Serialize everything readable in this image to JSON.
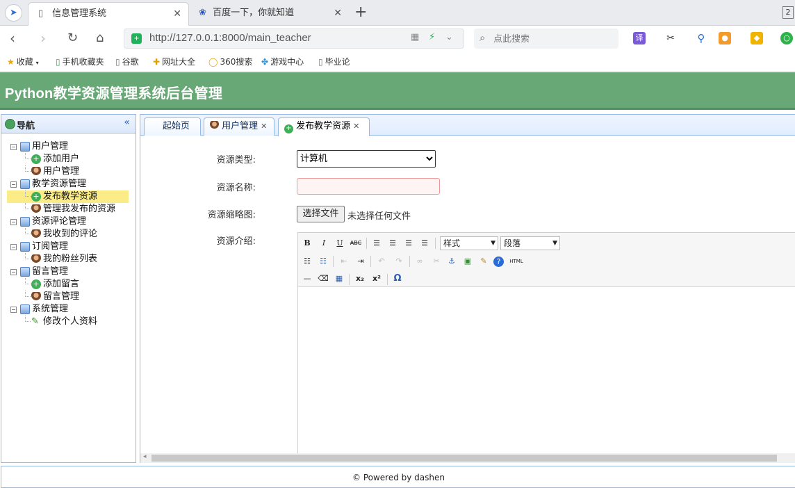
{
  "browser": {
    "tabs": [
      {
        "title": "信息管理系统",
        "active": true
      },
      {
        "title": "百度一下，你就知道",
        "active": false
      }
    ],
    "tab_count": "2",
    "url_prefix": "http://127.0.0.1",
    "url_rest": ":8000/main_teacher",
    "search_placeholder": "点此搜索",
    "translate_label": "译",
    "bookmarks": [
      "收藏",
      "手机收藏夹",
      "谷歌",
      "网址大全",
      "360搜索",
      "游戏中心",
      "毕业论"
    ]
  },
  "app": {
    "title": "Python教学资源管理系统后台管理",
    "nav_title": "导航",
    "nav_collapse": "«",
    "tree": [
      {
        "label": "用户管理",
        "level": 0,
        "icon": "folder-icon"
      },
      {
        "label": "添加用户",
        "level": 1,
        "icon": "add-icon"
      },
      {
        "label": "用户管理",
        "level": 1,
        "icon": "user-icon"
      },
      {
        "label": "教学资源管理",
        "level": 0,
        "icon": "folder-icon"
      },
      {
        "label": "发布教学资源",
        "level": 1,
        "icon": "add-icon",
        "selected": true
      },
      {
        "label": "管理我发布的资源",
        "level": 1,
        "icon": "user-icon"
      },
      {
        "label": "资源评论管理",
        "level": 0,
        "icon": "folder-icon"
      },
      {
        "label": "我收到的评论",
        "level": 1,
        "icon": "user-icon"
      },
      {
        "label": "订阅管理",
        "level": 0,
        "icon": "folder-icon"
      },
      {
        "label": "我的粉丝列表",
        "level": 1,
        "icon": "user-icon"
      },
      {
        "label": "留言管理",
        "level": 0,
        "icon": "folder-icon"
      },
      {
        "label": "添加留言",
        "level": 1,
        "icon": "add-icon"
      },
      {
        "label": "留言管理",
        "level": 1,
        "icon": "user-icon"
      },
      {
        "label": "系统管理",
        "level": 0,
        "icon": "folder-icon"
      },
      {
        "label": "修改个人资料",
        "level": 1,
        "icon": "edit-icon"
      }
    ],
    "main_tabs": [
      {
        "label": "起始页",
        "closable": false
      },
      {
        "label": "用户管理",
        "closable": true
      },
      {
        "label": "发布教学资源",
        "closable": true,
        "active": true
      }
    ],
    "form": {
      "type_label": "资源类型:",
      "type_value": "计算机",
      "name_label": "资源名称:",
      "name_value": "",
      "thumb_label": "资源缩略图:",
      "file_button": "选择文件",
      "file_status": "未选择任何文件",
      "intro_label": "资源介绍:"
    },
    "editor": {
      "style_select": "样式",
      "format_select": "段落",
      "html_label": "HTML",
      "omega_label": "Ω"
    },
    "footer": "© Powered by dashen"
  }
}
